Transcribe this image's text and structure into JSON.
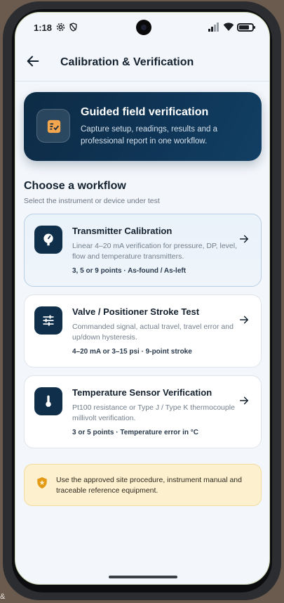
{
  "status": {
    "time": "1:18"
  },
  "appbar": {
    "title": "Calibration & Verification"
  },
  "hero": {
    "title": "Guided field verification",
    "description": "Capture setup, readings, results and a professional report in one workflow."
  },
  "section": {
    "title": "Choose a workflow",
    "subtitle": "Select the instrument or device under test"
  },
  "workflows": [
    {
      "title": "Transmitter Calibration",
      "description": "Linear 4–20 mA verification for pressure, DP, level, flow and temperature transmitters.",
      "meta": "3, 5 or 9 points · As-found / As-left",
      "icon": "gauge-icon"
    },
    {
      "title": "Valve / Positioner Stroke Test",
      "description": "Commanded signal, actual travel, travel error and up/down hysteresis.",
      "meta": "4–20 mA or 3–15 psi · 9-point stroke",
      "icon": "sliders-icon"
    },
    {
      "title": "Temperature Sensor Verification",
      "description": "Pt100 resistance or Type J / Type K thermocouple millivolt verification.",
      "meta": "3 or 5 points · Temperature error in °C",
      "icon": "thermometer-icon"
    }
  ],
  "notice": {
    "text": "Use the approved site procedure, instrument manual and traceable reference equipment."
  },
  "colors": {
    "hero_bg": "#0f3556",
    "icon_tile": "#0f2f4b",
    "notice_bg": "#fdf0cf",
    "notice_icon": "#e39b15"
  },
  "overflow": {
    "corner_text": "&"
  }
}
